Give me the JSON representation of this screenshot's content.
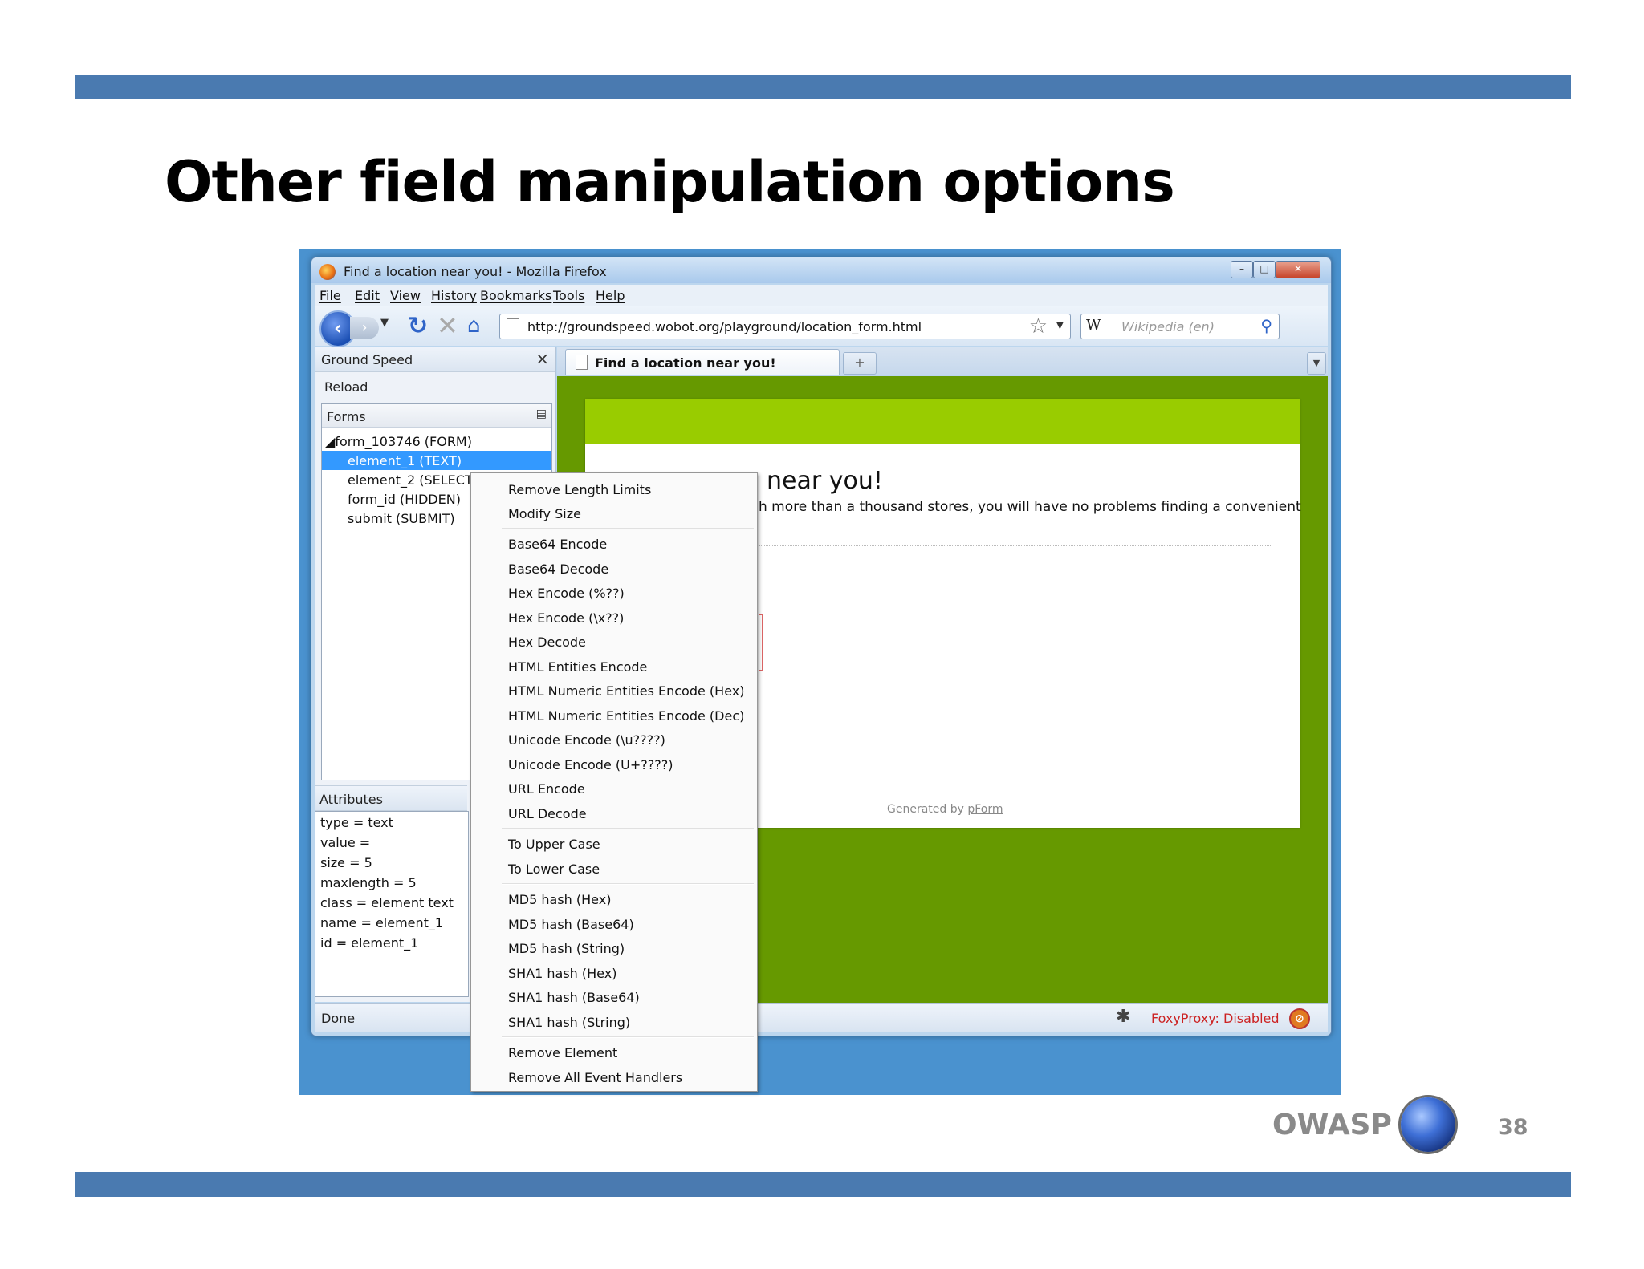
{
  "slide": {
    "title": "Other field manipulation options",
    "footer_brand": "OWASP",
    "page_number": "38",
    "bar_color": "#4a7ab0"
  },
  "browser": {
    "window_title": "Find a location near you! - Mozilla Firefox",
    "window_buttons": [
      "minimize",
      "maximize",
      "close"
    ],
    "menu": [
      "File",
      "Edit",
      "View",
      "History",
      "Bookmarks",
      "Tools",
      "Help"
    ],
    "url": "http://groundspeed.wobot.org/playground/location_form.html",
    "search_engine_icon": "W",
    "search_placeholder": "Wikipedia (en)",
    "tab_label": "Find a location near you!",
    "status": "Done",
    "foxyproxy": "FoxyProxy: Disabled"
  },
  "sidebar": {
    "title": "Ground Speed",
    "reload": "Reload",
    "forms_label": "Forms",
    "tree": [
      {
        "label": "◢form_103746 (FORM)"
      },
      {
        "label": "element_1 (TEXT)",
        "selected": true
      },
      {
        "label": "element_2 (SELECT)"
      },
      {
        "label": "form_id (HIDDEN)"
      },
      {
        "label": "submit (SUBMIT)"
      }
    ],
    "attributes_label": "Attributes",
    "attributes": [
      "type = text",
      "value =",
      "size = 5",
      "maxlength = 5",
      "class = element text",
      "name = element_1",
      "id = element_1"
    ]
  },
  "page": {
    "heading": "near you!",
    "intro": "h more than a thousand stores, you will have no problems finding a convenient",
    "generated_by": "Generated by ",
    "generated_link": "pForm",
    "header_color": "#99cc00",
    "background_color": "#669900"
  },
  "context_menu": {
    "groups": [
      [
        "Remove Length Limits",
        "Modify Size"
      ],
      [
        "Base64 Encode",
        "Base64 Decode",
        "Hex Encode (%??)",
        "Hex Encode (\\x??)",
        "Hex Decode",
        "HTML Entities Encode",
        "HTML Numeric Entities Encode (Hex)",
        "HTML Numeric Entities Encode (Dec)",
        "Unicode Encode (\\u????)",
        "Unicode Encode (U+????)",
        "URL Encode",
        "URL Decode"
      ],
      [
        "To Upper Case",
        "To Lower Case"
      ],
      [
        "MD5 hash (Hex)",
        "MD5 hash (Base64)",
        "MD5 hash (String)",
        "SHA1 hash (Hex)",
        "SHA1 hash (Base64)",
        "SHA1 hash (String)"
      ],
      [
        "Remove Element",
        "Remove All Event Handlers"
      ]
    ]
  }
}
